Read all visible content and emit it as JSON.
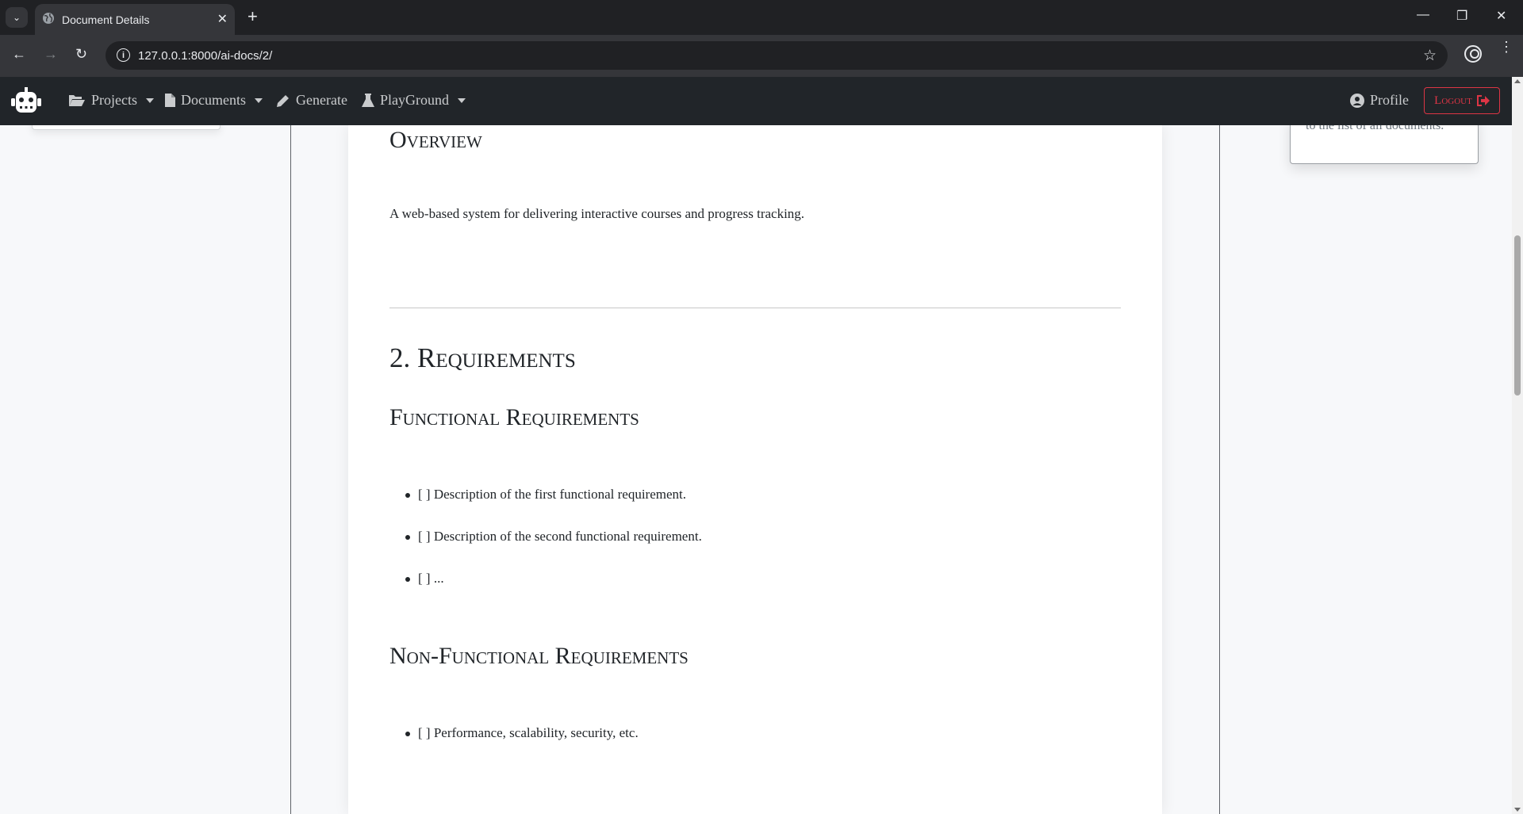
{
  "browser": {
    "tab_title": "Document Details",
    "new_tab": "+",
    "url_host": "127.0.0.1",
    "url_rest": ":8000/ai-docs/2/",
    "minimize": "—",
    "restore": "❐",
    "close": "✕"
  },
  "navbar": {
    "projects": "Projects",
    "documents": "Documents",
    "generate": "Generate",
    "playground": "PlayGround",
    "profile": "Profile",
    "logout": "Logout",
    "accent_color": "#dc3545"
  },
  "sidebar_card": {
    "text": "to the list of all documents."
  },
  "document": {
    "overview_heading": "Overview",
    "overview_text": "A web-based system for delivering interactive courses and progress tracking.",
    "requirements_heading": "2. Requirements",
    "functional_heading": "Functional Requirements",
    "functional_items": [
      "[ ] Description of the first functional requirement.",
      "[ ] Description of the second functional requirement.",
      "[ ] ..."
    ],
    "nonfunctional_heading": "Non-Functional Requirements",
    "nonfunctional_items": [
      "[ ] Performance, scalability, security, etc."
    ]
  }
}
